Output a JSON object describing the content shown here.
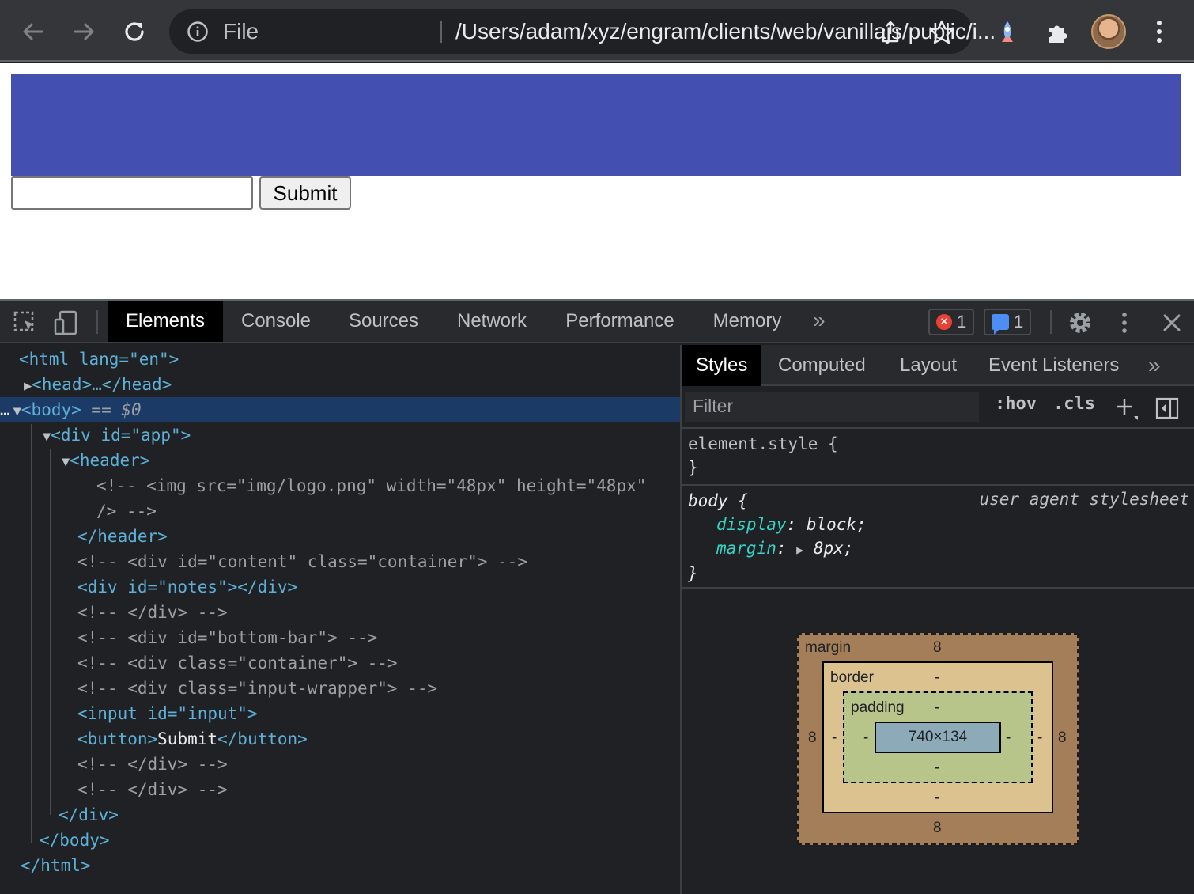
{
  "browser": {
    "omnibox": {
      "scheme": "File",
      "url": "/Users/adam/xyz/engram/clients/web/vanillajs/public/i..."
    }
  },
  "page": {
    "input_value": "",
    "submit_label": "Submit",
    "header_color": "#444fb2"
  },
  "devtools": {
    "tabs": [
      "Elements",
      "Console",
      "Sources",
      "Network",
      "Performance",
      "Memory"
    ],
    "more_tabs": "»",
    "error_count": "1",
    "message_count": "1",
    "dom": {
      "l0": "<html lang=\"en\">",
      "l1": "<head>…</head>",
      "l2_tag": "<body>",
      "l2_eq": "== $0",
      "l3": "<div id=\"app\">",
      "l4": "<header>",
      "l5": "<!-- <img src=\"img/logo.png\" width=\"48px\" height=\"48px\"",
      "l6": "/> -->",
      "l7": "</header>",
      "l8": "<!-- <div id=\"content\" class=\"container\"> -->",
      "l9": "<div id=\"notes\"></div>",
      "l10": "<!-- </div> -->",
      "l11": "<!-- <div id=\"bottom-bar\"> -->",
      "l12": "<!-- <div class=\"container\"> -->",
      "l13": "<!-- <div class=\"input-wrapper\"> -->",
      "l14": "<input id=\"input\">",
      "l15_open": "<button>",
      "l15_text": "Submit",
      "l15_close": "</button>",
      "l16": "<!-- </div> -->",
      "l17": "<!-- </div> -->",
      "l18": "</div>",
      "l19": "</body>",
      "l20": "</html>"
    },
    "styles": {
      "tabs": [
        "Styles",
        "Computed",
        "Layout",
        "Event Listeners"
      ],
      "filter_placeholder": "Filter",
      "hov": ":hov",
      "cls": ".cls",
      "element_style": "element.style {",
      "close_brace": "}",
      "body_selector": "body {",
      "origin": "user agent stylesheet",
      "display_prop": "display",
      "display_val": "block;",
      "margin_prop": "margin",
      "margin_val": "8px;",
      "box_model": {
        "margin_label": "margin",
        "border_label": "border",
        "padding_label": "padding",
        "margin_top": "8",
        "margin_bottom": "8",
        "margin_left": "8",
        "margin_right": "8",
        "border_top": "-",
        "border_bottom": "-",
        "border_left": "-",
        "border_right": "-",
        "padding_top": "-",
        "padding_bottom": "-",
        "padding_left": "-",
        "padding_right": "-",
        "content": "740×134"
      }
    }
  }
}
